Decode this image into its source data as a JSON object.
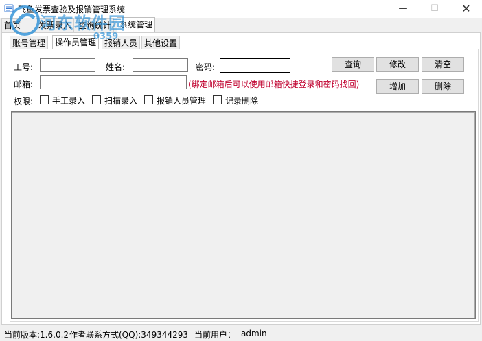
{
  "window": {
    "title": "飞鱼发票查验及报销管理系统",
    "minimize": "—",
    "maximize": "☐",
    "close": "✕",
    "icon": "app-icon"
  },
  "main_tabs": [
    {
      "label": "首页"
    },
    {
      "label": "发票录入"
    },
    {
      "label": "查询统计"
    },
    {
      "label": "系统管理",
      "active": true
    }
  ],
  "sub_tabs": [
    {
      "label": "账号管理"
    },
    {
      "label": "操作员管理",
      "active": true
    },
    {
      "label": "报销人员"
    },
    {
      "label": "其他设置"
    }
  ],
  "form": {
    "employee_id_label": "工号:",
    "employee_id_value": "",
    "name_label": "姓名:",
    "name_value": "",
    "password_label": "密码:",
    "password_value": "",
    "email_label": "邮箱:",
    "email_value": "",
    "email_hint": "(绑定邮箱后可以使用邮箱快捷登录和密码找回)",
    "permissions_label": "权限:",
    "permissions": [
      {
        "label": "手工录入",
        "checked": false
      },
      {
        "label": "扫描录入",
        "checked": false
      },
      {
        "label": "报销人员管理",
        "checked": false
      },
      {
        "label": "记录删除",
        "checked": false
      }
    ]
  },
  "buttons": {
    "query": "查询",
    "modify": "修改",
    "clear": "清空",
    "add": "增加",
    "delete": "删除"
  },
  "status_bar": {
    "version": "当前版本:1.6.0.2",
    "contact": "作者联系方式(QQ):349344293",
    "current_user_label": "当前用户：",
    "current_user": "admin"
  },
  "watermark": {
    "text": "河东软件园",
    "sub": "0359",
    "accent": "#2a8fd6"
  }
}
